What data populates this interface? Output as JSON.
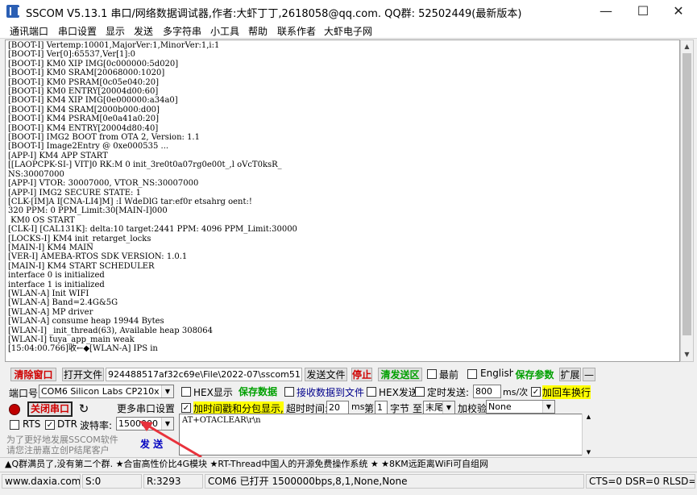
{
  "window": {
    "title": "SSCOM V5.13.1 串口/网络数据调试器,作者:大虾丁丁,2618058@qq.com. QQ群: 52502449(最新版本)",
    "minimize": "—",
    "maximize": "☐",
    "close": "✕"
  },
  "menu": [
    "通讯端口",
    "串口设置",
    "显示",
    "发送",
    "多字符串",
    "小工具",
    "帮助",
    "联系作者",
    "大虾电子网"
  ],
  "terminal": {
    "lines": [
      "[BOOT-I] Vertemp:10001,MajorVer:1,MinorVer:1,i:1",
      "[BOOT-I] Ver[0]:65537,Ver[1]:0",
      "[BOOT-I] KM0 XIP IMG[0c000000:5d020]",
      "[BOOT-I] KM0 SRAM[20068000:1020]",
      "[BOOT-I] KM0 PSRAM[0c05e040:20]",
      "[BOOT-I] KM0 ENTRY[20004d00:60]",
      "[BOOT-I] KM4 XIP IMG[0e000000:a34a0]",
      "[BOOT-I] KM4 SRAM[2000b000:d00]",
      "[BOOT-I] KM4 PSRAM[0e0a41a0:20]",
      "[BOOT-I] KM4 ENTRY[20004d80:40]",
      "[BOOT-I] IMG2 BOOT from OTA 2, Version: 1.1",
      "[BOOT-I] Image2Entry @ 0xe000535 ...",
      "[APP-I] KM4 APP START",
      "[[LAOPCPK-SI-] VIT]0 RK:M 0 init_3re0t0a07rg0e00t_,l oVcT0ksR_",
      "NS:30007000",
      "[APP-I] VTOR: 30007000, VTOR_NS:30007000",
      "[APP-I] IMG2 SECURE STATE: 1",
      "[CLK-[IM]A I[CNA-LI4]M] :I WdeDlG tar:ef0r etsahrg oent:!",
      "320 PPM: 0 PPM_Limit:30[MAIN-I]000",
      " KM0 OS START",
      "[CLK-I] [CAL131K]: delta:10 target:2441 PPM: 4096 PPM_Limit:30000",
      "[LOCKS-I] KM4 init_retarget_locks",
      "[MAIN-I] KM4 MAIN",
      "[VER-I] AMEBA-RTOS SDK VERSION: 1.0.1",
      "[MAIN-I] KM4 START SCHEDULER",
      "interface 0 is initialized",
      "interface 1 is initialized",
      "[WLAN-A] Init WIFI",
      "[WLAN-A] Band=2.4G&5G",
      "[WLAN-A] MP driver",
      "[WLAN-A] consume heap 19944 Bytes",
      "[WLAN-I] _init_thread(63), Available heap 308064",
      "[WLAN-I] tuya_app_main weak",
      "[15:04:00.766]收←◆[WLAN-A] IPS in"
    ]
  },
  "toolbar": {
    "clear_window": "清除窗口",
    "open_file": "打开文件",
    "file_path": "924488517af32c69e\\File\\2022-07\\sscom51.ini",
    "send_file": "发送文件",
    "stop": "停止",
    "clear_send_area": "清发送区",
    "topmost": "最前",
    "english": "English",
    "save_params": "保存参数",
    "expand": "扩展",
    "collapse": "—"
  },
  "port": {
    "port_label": "端口号",
    "port_value": "COM6 Silicon Labs CP210x U",
    "close_port": "关闭串口",
    "more_settings": "更多串口设置",
    "rts": "RTS",
    "dtr": "DTR",
    "baud_label": "波特率:",
    "baud_value": "1500000"
  },
  "options": {
    "hex_display": "HEX显示",
    "save_data": "保存数据",
    "recv_to_file": "接收数据到文件",
    "hex_send": "HEX发送",
    "timed_send": "定时发送:",
    "timed_value": "800",
    "timed_unit": "ms/次",
    "add_crlf": "加回车换行",
    "timestamp": "加时间戳和分包显示,",
    "timeout_label": "超时时间:",
    "timeout_value": "20",
    "ms": "ms",
    "byte_prefix": "第",
    "byte_index": "1",
    "byte_suffix": "字节",
    "to": "至",
    "end_value": "末尾",
    "checksum_label": "加校验",
    "checksum_value": "None"
  },
  "send": {
    "content": "AT+OTACLEAR\\r\\n",
    "send_button": "发 送",
    "hint_line1": "为了更好地发展SSCOM软件",
    "hint_line2": "请您注册嘉立创P结尾客户"
  },
  "banner": "▲Q群满员了,没有第二个群. ★合宙高性价比4G模块 ★RT-Thread中国人的开源免费操作系统 ★ ★8KM远距离WiFi可自组网",
  "status": {
    "website": "www.daxia.com",
    "sent": "S:0",
    "received": "R:3293",
    "port_state": "COM6 已打开  1500000bps,8,1,None,None",
    "signals": "CTS=0 DSR=0 RLSD="
  },
  "colors": {
    "red": "#d00000",
    "green": "#00a000",
    "highlight": "#ffff00",
    "annotation_arrow": "#e8323c"
  }
}
